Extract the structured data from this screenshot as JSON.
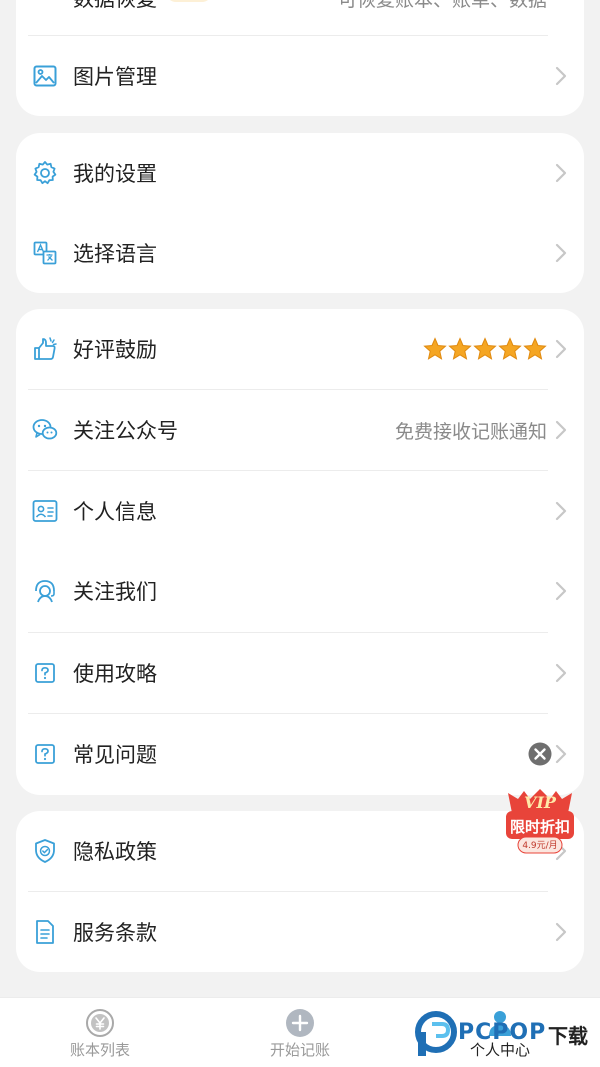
{
  "menu_group_1": {
    "items": [
      {
        "label": "数据恢复",
        "right_text": "可恢复账本、账单、数据",
        "icon": "restore-icon"
      },
      {
        "label": "图片管理",
        "icon": "image-icon"
      }
    ]
  },
  "menu_group_2": {
    "items": [
      {
        "label": "我的设置",
        "icon": "gear-icon"
      },
      {
        "label": "选择语言",
        "icon": "translate-icon"
      }
    ]
  },
  "menu_group_3": {
    "items": [
      {
        "label": "好评鼓励",
        "icon": "thumbs-up-icon",
        "rating": 5
      },
      {
        "label": "关注公众号",
        "right_text": "免费接收记账通知",
        "icon": "wechat-icon"
      },
      {
        "label": "个人信息",
        "icon": "id-card-icon"
      },
      {
        "label": "关注我们",
        "icon": "headset-icon"
      },
      {
        "label": "使用攻略",
        "icon": "help-icon"
      },
      {
        "label": "常见问题",
        "icon": "help-icon"
      }
    ]
  },
  "menu_group_4": {
    "items": [
      {
        "label": "隐私政策",
        "icon": "shield-icon"
      },
      {
        "label": "服务条款",
        "icon": "document-icon"
      }
    ]
  },
  "vip_promo": {
    "title": "VIP",
    "subtitle": "限时折扣",
    "price": "4.9元/月"
  },
  "tabbar": {
    "tabs": [
      {
        "label": "账本列表",
        "icon": "yen-icon"
      },
      {
        "label": "开始记账",
        "icon": "plus-icon"
      },
      {
        "label": "个人中心",
        "icon": "person-icon"
      }
    ]
  },
  "watermark": {
    "brand": "PCPOP",
    "suffix": "下载"
  },
  "colors": {
    "accent": "#3aa0d8",
    "star": "#f5a623",
    "background": "#f2f2f2"
  }
}
